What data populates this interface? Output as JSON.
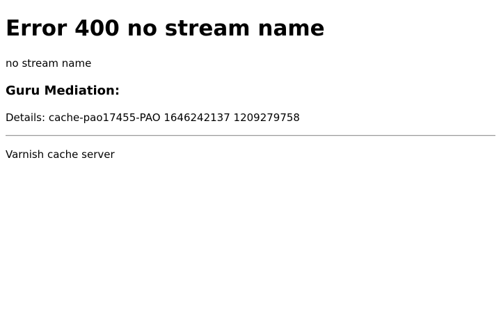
{
  "error": {
    "heading": "Error 400 no stream name",
    "message": "no stream name"
  },
  "guru": {
    "heading": "Guru Mediation:",
    "details": "Details: cache-pao17455-PAO 1646242137 1209279758"
  },
  "footer": {
    "server": "Varnish cache server"
  }
}
